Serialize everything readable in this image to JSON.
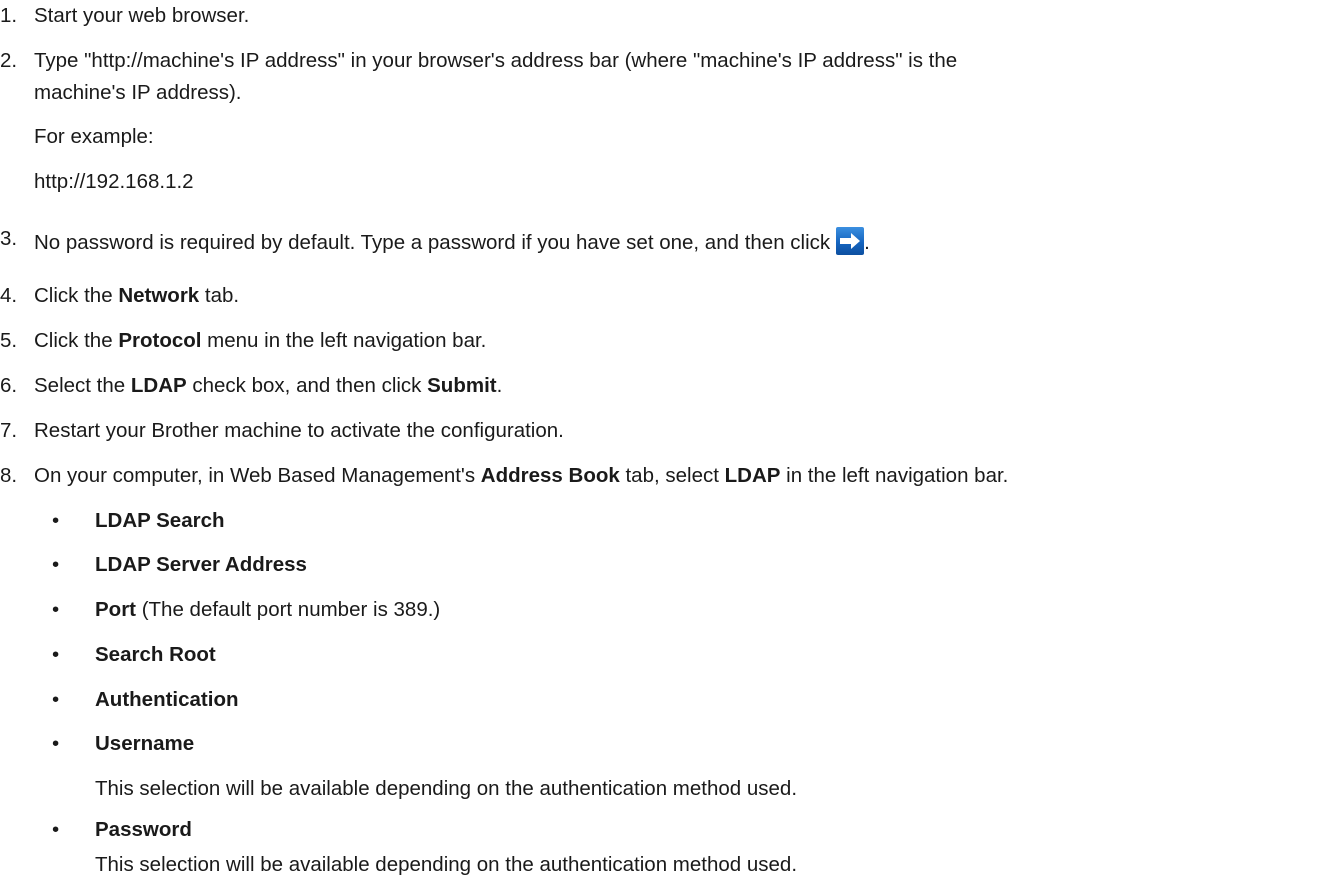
{
  "steps": [
    {
      "num": "1.",
      "text": "Start your web browser."
    },
    {
      "num": "2.",
      "text": "Type \"http://machine's IP address\" in your browser's address bar (where \"machine's IP address\" is the",
      "cont": "machine's IP address).",
      "example_label": "For example:",
      "example_url": "http://192.168.1.2"
    },
    {
      "num": "3.",
      "text": "No password is required by default. Type a password if you have set one, and then click",
      "after_icon": "."
    },
    {
      "num": "4.",
      "pre": "Click the ",
      "bold": "Network",
      "post": " tab."
    },
    {
      "num": "5.",
      "pre": "Click the ",
      "bold": "Protocol",
      "post": " menu in the left navigation bar."
    },
    {
      "num": "6.",
      "pre": "Select the ",
      "bold": "LDAP",
      "mid": " check box, and then click ",
      "bold2": "Submit",
      "post": "."
    },
    {
      "num": "7.",
      "text": "Restart your Brother machine to activate the configuration."
    },
    {
      "num": "8.",
      "pre": "On your computer, in Web Based Management's ",
      "bold": "Address Book",
      "mid": " tab, select ",
      "bold2": "LDAP",
      "post": " in the left navigation bar."
    }
  ],
  "bullet_char": "•",
  "bullets": [
    {
      "label": "LDAP Search"
    },
    {
      "label": "LDAP Server Address"
    },
    {
      "label": "Port",
      "note": " (The default port number is 389.)"
    },
    {
      "label": "Search Root"
    },
    {
      "label": "Authentication"
    },
    {
      "label": "Username",
      "desc": "This selection will be available depending on the authentication method used."
    },
    {
      "label": "Password",
      "desc": "This selection will be available depending on the authentication method used."
    }
  ],
  "icons": {
    "submit_arrow": "right-arrow-icon"
  },
  "colors": {
    "text": "#1a1a1a",
    "icon_bg": "#1565c0",
    "icon_arrow": "#ffffff"
  }
}
